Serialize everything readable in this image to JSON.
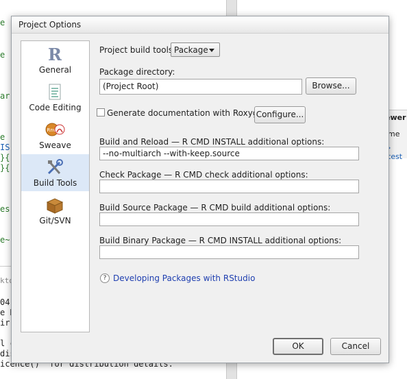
{
  "background": {
    "code_lines": [
      "e",
      "e",
      "ar",
      "e",
      "IS",
      "}{",
      "}{",
      "es",
      "e~"
    ],
    "console_lines": [
      "04",
      "e R",
      "ir",
      "l c",
      "dis",
      "icence()  for distribution details."
    ],
    "tab_fragment": "kto",
    "pane_title": "ewer",
    "pane_col": "me",
    "pane_item": "› test"
  },
  "dialog": {
    "title": "Project Options",
    "sidebar": [
      {
        "label": "General",
        "icon": "r-logo-icon"
      },
      {
        "label": "Code Editing",
        "icon": "document-icon"
      },
      {
        "label": "Sweave",
        "icon": "sweave-pdf-icon"
      },
      {
        "label": "Build Tools",
        "icon": "tools-icon",
        "active": true
      },
      {
        "label": "Git/SVN",
        "icon": "package-box-icon"
      }
    ],
    "build_tools_label": "Project build tools:",
    "build_tools_value": "Package",
    "package_directory_label": "Package directory:",
    "package_directory_value": "(Project Root)",
    "browse_label": "Browse...",
    "roxygen_label": "Generate documentation with Roxygen",
    "roxygen_checked": false,
    "configure_label": "Configure...",
    "build_reload_label": "Build and Reload — R CMD INSTALL additional options:",
    "build_reload_value": "--no-multiarch --with-keep.source",
    "check_label": "Check Package — R CMD check additional options:",
    "check_value": "",
    "build_source_label": "Build Source Package — R CMD build additional options:",
    "build_source_value": "",
    "build_binary_label": "Build Binary Package — R CMD INSTALL additional options:",
    "build_binary_value": "",
    "help_icon": "question-mark-icon",
    "help_link": "Developing Packages with RStudio",
    "ok_label": "OK",
    "cancel_label": "Cancel"
  }
}
